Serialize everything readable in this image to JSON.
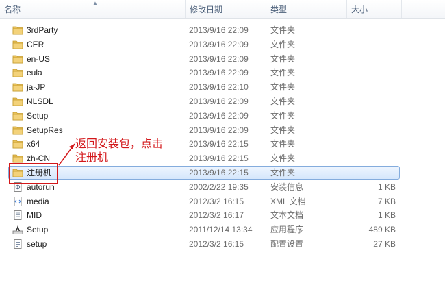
{
  "columns": {
    "name": "名称",
    "date": "修改日期",
    "type": "类型",
    "size": "大小"
  },
  "files": [
    {
      "name": "3rdParty",
      "date": "2013/9/16 22:09",
      "type": "文件夹",
      "size": "",
      "icon": "folder-icon"
    },
    {
      "name": "CER",
      "date": "2013/9/16 22:09",
      "type": "文件夹",
      "size": "",
      "icon": "folder-icon"
    },
    {
      "name": "en-US",
      "date": "2013/9/16 22:09",
      "type": "文件夹",
      "size": "",
      "icon": "folder-icon"
    },
    {
      "name": "eula",
      "date": "2013/9/16 22:09",
      "type": "文件夹",
      "size": "",
      "icon": "folder-icon"
    },
    {
      "name": "ja-JP",
      "date": "2013/9/16 22:10",
      "type": "文件夹",
      "size": "",
      "icon": "folder-icon"
    },
    {
      "name": "NLSDL",
      "date": "2013/9/16 22:09",
      "type": "文件夹",
      "size": "",
      "icon": "folder-icon"
    },
    {
      "name": "Setup",
      "date": "2013/9/16 22:09",
      "type": "文件夹",
      "size": "",
      "icon": "folder-icon"
    },
    {
      "name": "SetupRes",
      "date": "2013/9/16 22:09",
      "type": "文件夹",
      "size": "",
      "icon": "folder-icon"
    },
    {
      "name": "x64",
      "date": "2013/9/16 22:15",
      "type": "文件夹",
      "size": "",
      "icon": "folder-icon"
    },
    {
      "name": "zh-CN",
      "date": "2013/9/16 22:15",
      "type": "文件夹",
      "size": "",
      "icon": "folder-icon"
    },
    {
      "name": "注册机",
      "date": "2013/9/16 22:15",
      "type": "文件夹",
      "size": "",
      "icon": "folder-icon",
      "selected": true
    },
    {
      "name": "autorun",
      "date": "2002/2/22 19:35",
      "type": "安装信息",
      "size": "1 KB",
      "icon": "settings-file-icon"
    },
    {
      "name": "media",
      "date": "2012/3/2 16:15",
      "type": "XML 文档",
      "size": "7 KB",
      "icon": "xml-file-icon"
    },
    {
      "name": "MID",
      "date": "2012/3/2 16:17",
      "type": "文本文档",
      "size": "1 KB",
      "icon": "text-file-icon"
    },
    {
      "name": "Setup",
      "date": "2011/12/14 13:34",
      "type": "应用程序",
      "size": "489 KB",
      "icon": "setup-app-icon"
    },
    {
      "name": "setup",
      "date": "2012/3/2 16:15",
      "type": "配置设置",
      "size": "27 KB",
      "icon": "config-file-icon"
    }
  ],
  "annotation": {
    "line1": "返回安装包，点击",
    "line2": "注册机"
  },
  "colors": {
    "annotation": "#d3181b",
    "selection_border": "#84acdd",
    "folder": "#e8c15a"
  }
}
